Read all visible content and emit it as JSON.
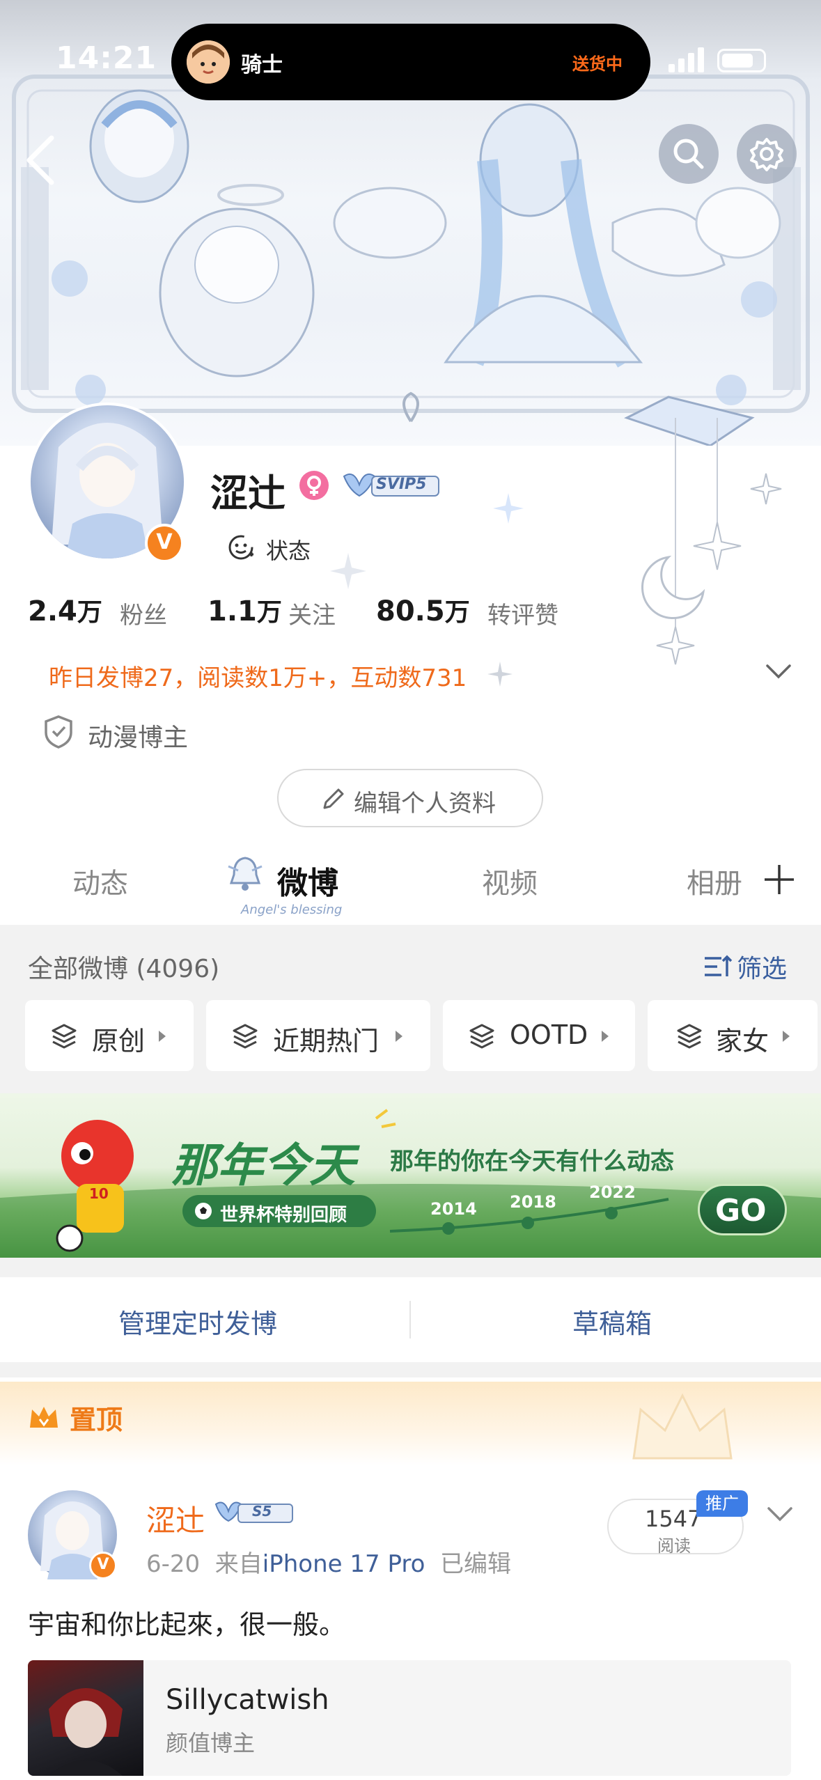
{
  "status_bar": {
    "time": "14:21"
  },
  "live_activity": {
    "label": "骑士",
    "status": "送货中"
  },
  "profile": {
    "name": "涩辻",
    "svip_badge": "SVIP5",
    "status_label": "状态",
    "stats": [
      {
        "value": "2.4",
        "unit": "万",
        "label": "粉丝"
      },
      {
        "value": "1.1",
        "unit": "万",
        "label": "关注"
      },
      {
        "value": "80.5",
        "unit": "万",
        "label": "转评赞"
      }
    ],
    "yesterday_summary": "昨日发博27，阅读数1万+，互动数731",
    "tag": "动漫博主",
    "edit_button": "编辑个人资料"
  },
  "tabs": {
    "items": [
      "动态",
      "微博",
      "视频",
      "相册"
    ],
    "active_sub": "Angel's blessing"
  },
  "feed_header": {
    "all_label": "全部微博 (4096)",
    "filter_label": "筛选"
  },
  "chips": [
    "原创",
    "近期热门",
    "OOTD",
    "家女"
  ],
  "banner": {
    "title": "那年今天",
    "subtitle": "那年的你在今天有什么动态",
    "pill": "世界杯特别回顾",
    "years": [
      "2014",
      "2018",
      "2022"
    ],
    "go": "GO",
    "mascot_number": "10"
  },
  "manage": {
    "scheduled": "管理定时发博",
    "drafts": "草稿箱"
  },
  "pinned_post": {
    "section_label": "置顶",
    "author": "涩辻",
    "badge": "S5",
    "date": "6-20",
    "from_prefix": "来自",
    "device": "iPhone 17 Pro",
    "edited": "已编辑",
    "read_count": "1547",
    "read_label": "阅读",
    "promo_label": "推广",
    "text": "宇宙和你比起來，很一般。",
    "card": {
      "title": "Sillycatwish",
      "subtitle": "颜值博主"
    }
  },
  "colors": {
    "accent_orange": "#ef6a1b",
    "link_blue": "#3f5f98",
    "vip_orange": "#f5821f"
  }
}
